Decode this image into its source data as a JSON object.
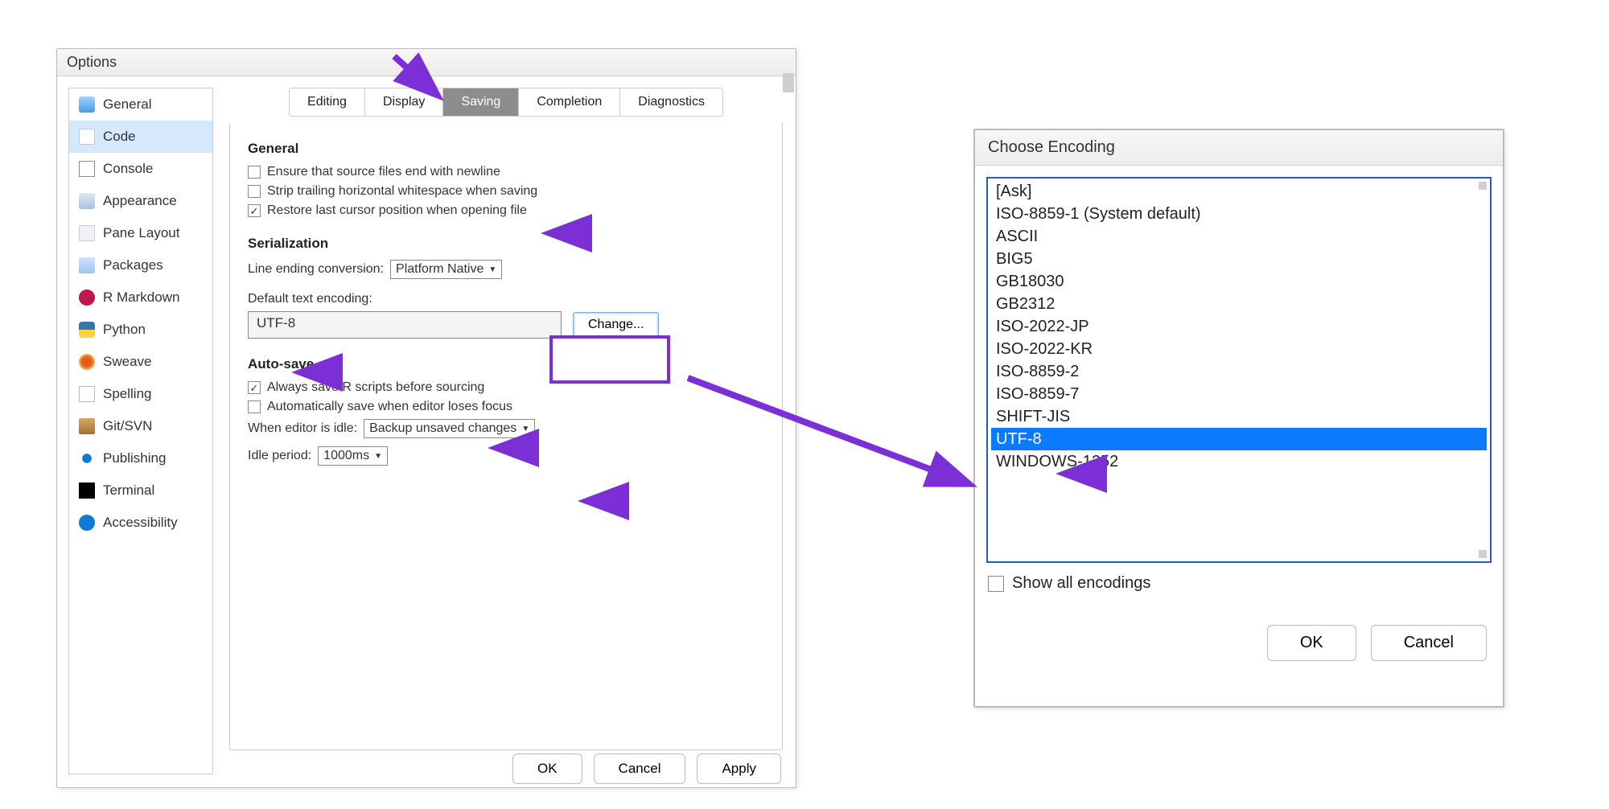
{
  "options": {
    "title": "Options",
    "sidebar": [
      {
        "id": "general",
        "label": "General"
      },
      {
        "id": "code",
        "label": "Code"
      },
      {
        "id": "console",
        "label": "Console"
      },
      {
        "id": "appearance",
        "label": "Appearance"
      },
      {
        "id": "pane",
        "label": "Pane Layout"
      },
      {
        "id": "packages",
        "label": "Packages"
      },
      {
        "id": "rmd",
        "label": "R Markdown"
      },
      {
        "id": "python",
        "label": "Python"
      },
      {
        "id": "sweave",
        "label": "Sweave"
      },
      {
        "id": "spelling",
        "label": "Spelling"
      },
      {
        "id": "git",
        "label": "Git/SVN"
      },
      {
        "id": "publishing",
        "label": "Publishing"
      },
      {
        "id": "terminal",
        "label": "Terminal"
      },
      {
        "id": "accessibility",
        "label": "Accessibility"
      }
    ],
    "tabs": {
      "editing": "Editing",
      "display": "Display",
      "saving": "Saving",
      "completion": "Completion",
      "diagnostics": "Diagnostics"
    },
    "saving": {
      "general_heading": "General",
      "ensure_newline": "Ensure that source files end with newline",
      "strip_ws": "Strip trailing horizontal whitespace when saving",
      "restore_cursor": "Restore last cursor position when opening file",
      "serialization_heading": "Serialization",
      "line_ending_label": "Line ending conversion:",
      "line_ending_value": "Platform Native",
      "default_enc_label": "Default text encoding:",
      "default_enc_value": "UTF-8",
      "change_btn": "Change...",
      "autosave_heading": "Auto-save",
      "always_save": "Always save R scripts before sourcing",
      "auto_save_focus": "Automatically save when editor loses focus",
      "idle_label": "When editor is idle:",
      "idle_value": "Backup unsaved changes",
      "idle_period_label": "Idle period:",
      "idle_period_value": "1000ms"
    },
    "buttons": {
      "ok": "OK",
      "cancel": "Cancel",
      "apply": "Apply"
    }
  },
  "encoding": {
    "title": "Choose Encoding",
    "items": [
      "[Ask]",
      "ISO-8859-1 (System default)",
      "ASCII",
      "BIG5",
      "GB18030",
      "GB2312",
      "ISO-2022-JP",
      "ISO-2022-KR",
      "ISO-8859-2",
      "ISO-8859-7",
      "SHIFT-JIS",
      "UTF-8",
      "WINDOWS-1252"
    ],
    "selected": "UTF-8",
    "show_all": "Show all encodings",
    "ok": "OK",
    "cancel": "Cancel"
  },
  "annotations": {
    "color": "#7c2fd6"
  }
}
